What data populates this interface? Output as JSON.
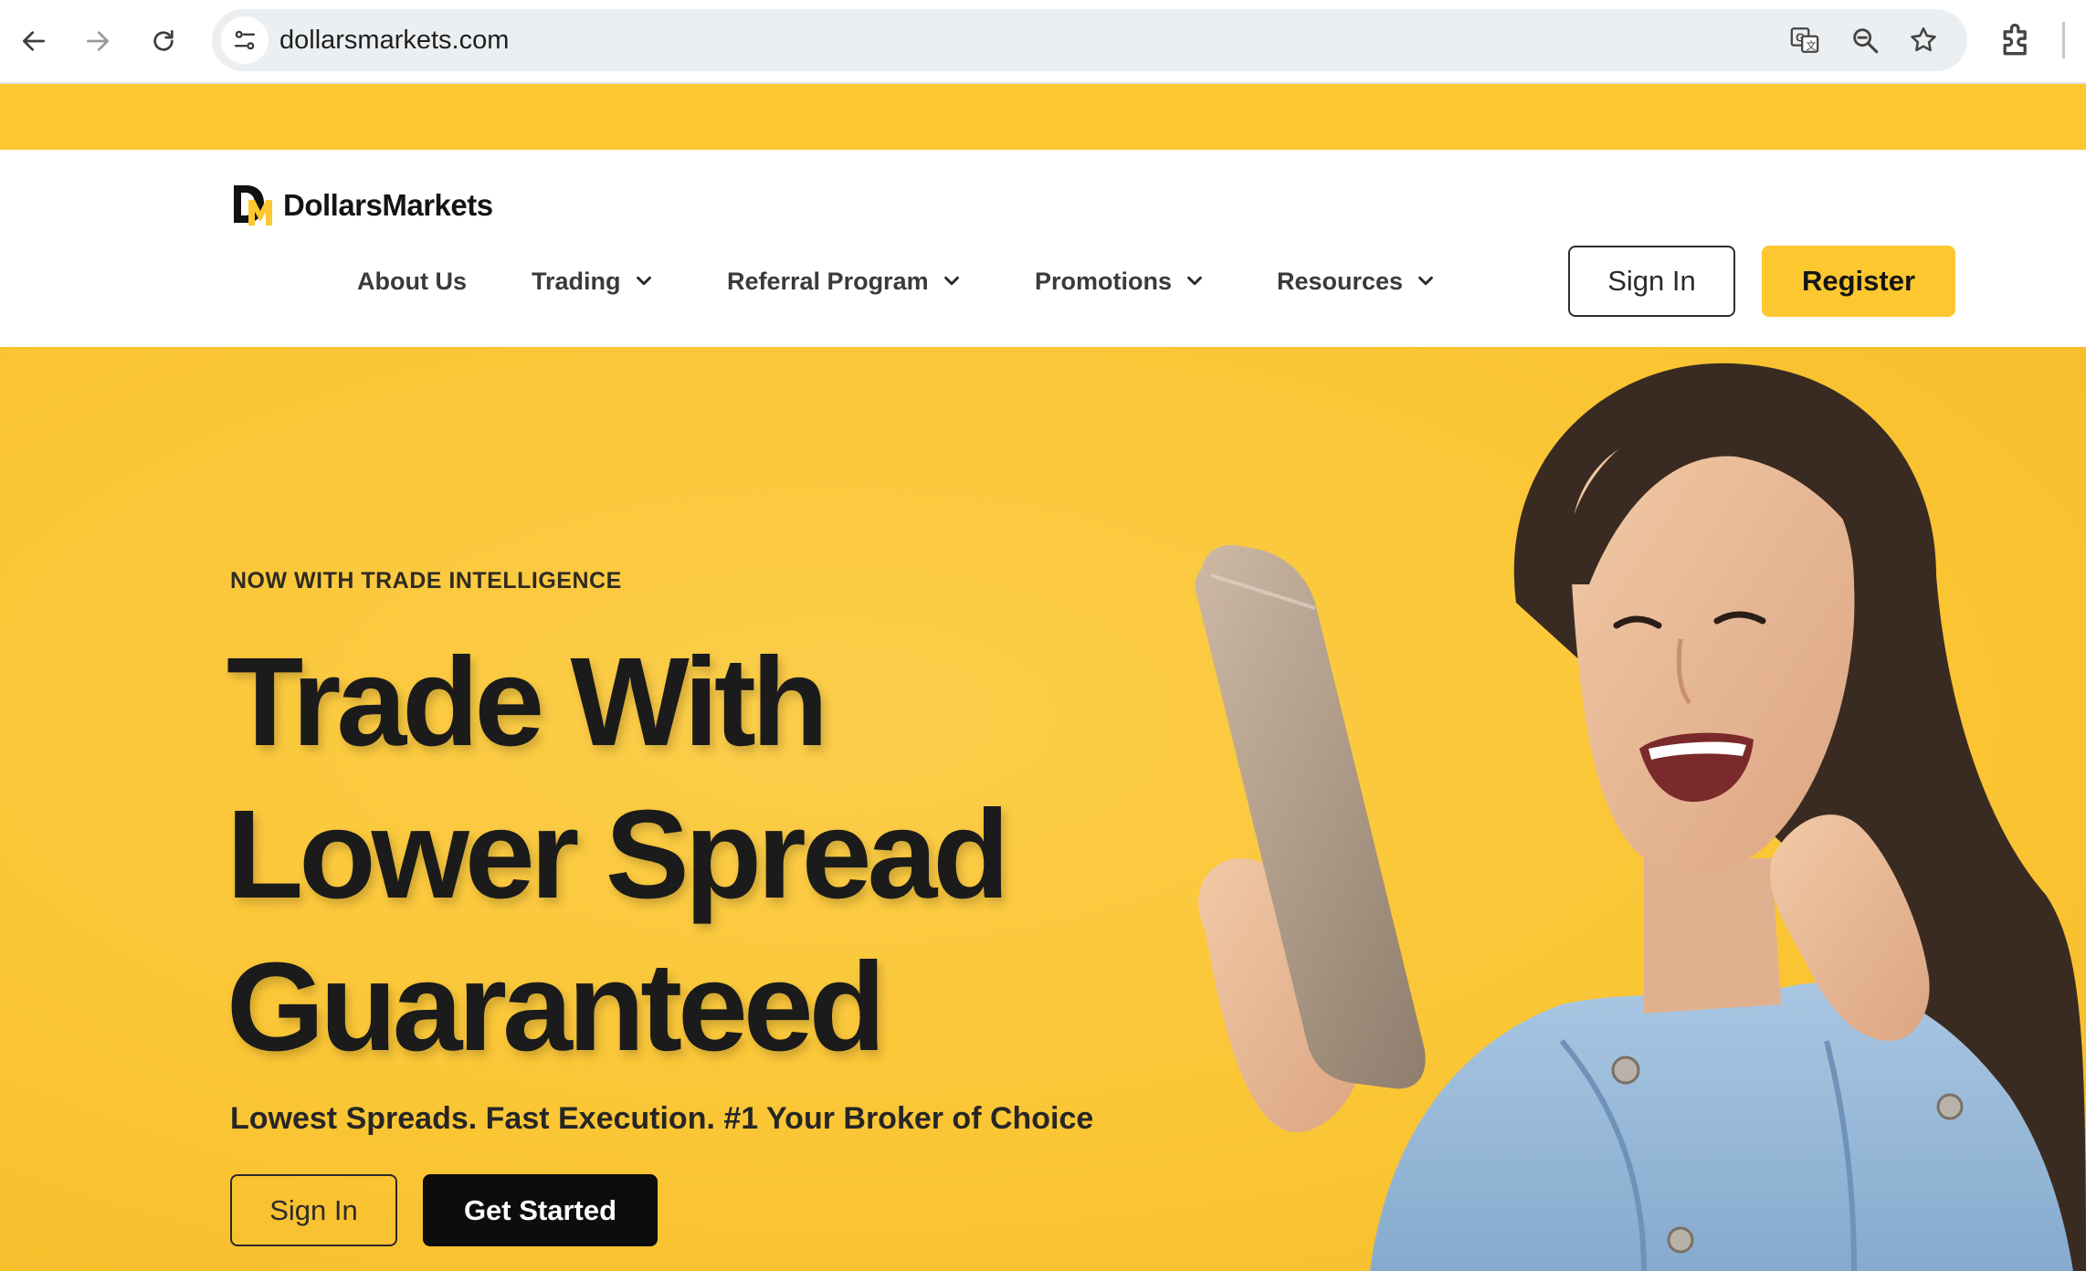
{
  "browser": {
    "url": "dollarsmarkets.com"
  },
  "site": {
    "logo_text": "DollarsMarkets",
    "nav": [
      {
        "label": "About Us"
      },
      {
        "label": "Trading"
      },
      {
        "label": "Referral Program"
      },
      {
        "label": "Promotions"
      },
      {
        "label": "Resources"
      }
    ],
    "sign_in_label": "Sign In",
    "register_label": "Register",
    "brand_color": "#fcc72f"
  },
  "hero": {
    "eyebrow": "NOW WITH TRADE INTELLIGENCE",
    "headline_lines": [
      "Trade With",
      "Lower Spread",
      "Guaranteed"
    ],
    "subhead": "Lowest Spreads. Fast Execution. #1 Your Broker of Choice",
    "sign_in_label": "Sign In",
    "cta_label": "Get Started"
  }
}
